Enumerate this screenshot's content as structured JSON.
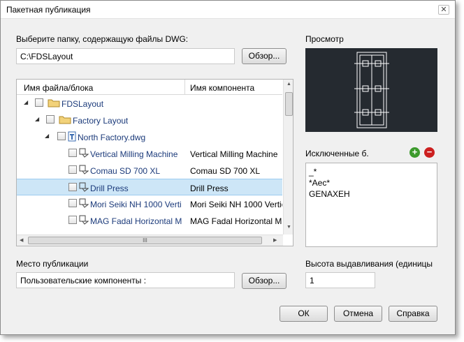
{
  "window": {
    "title": "Пакетная публикация",
    "close_label": "✕"
  },
  "folder": {
    "label": "Выберите папку, содержащую файлы DWG:",
    "path": "C:\\FDSLayout",
    "browse_label": "Обзор..."
  },
  "tree": {
    "columns": [
      "Имя файла/блока",
      "Имя компонента"
    ],
    "rows": [
      {
        "name": "FDSLayout",
        "component": ""
      },
      {
        "name": "Factory Layout",
        "component": ""
      },
      {
        "name": "North Factory.dwg",
        "component": ""
      },
      {
        "name": "Vertical Milling Machine",
        "component": "Vertical Milling Machine"
      },
      {
        "name": "Comau SD 700 XL",
        "component": "Comau SD 700 XL"
      },
      {
        "name": "Drill Press",
        "component": "Drill Press"
      },
      {
        "name": "Mori Seiki NH 1000 Verti",
        "component": "Mori Seiki NH 1000 Vertic"
      },
      {
        "name": "MAG Fadal Horizontal M",
        "component": "MAG Fadal Horizontal Ma"
      }
    ],
    "scroll_grip": "III"
  },
  "preview": {
    "label": "Просмотр"
  },
  "excluded": {
    "label": "Исключенные б.",
    "add_symbol": "+",
    "remove_symbol": "−",
    "items": [
      "_*",
      "*Aec*",
      "GENAXEH"
    ]
  },
  "publish": {
    "label": "Место публикации",
    "value": "Пользовательские компоненты :",
    "browse_label": "Обзор..."
  },
  "extrude": {
    "label": "Высота выдавливания (единицы (",
    "value": "1"
  },
  "buttons": {
    "ok": "ОК",
    "cancel": "Отмена",
    "help": "Справка"
  },
  "colors": {
    "selected_row": "#cde6f7",
    "preview_bg": "#252a30",
    "add": "#3c9a2c",
    "remove": "#cc1f1f"
  }
}
